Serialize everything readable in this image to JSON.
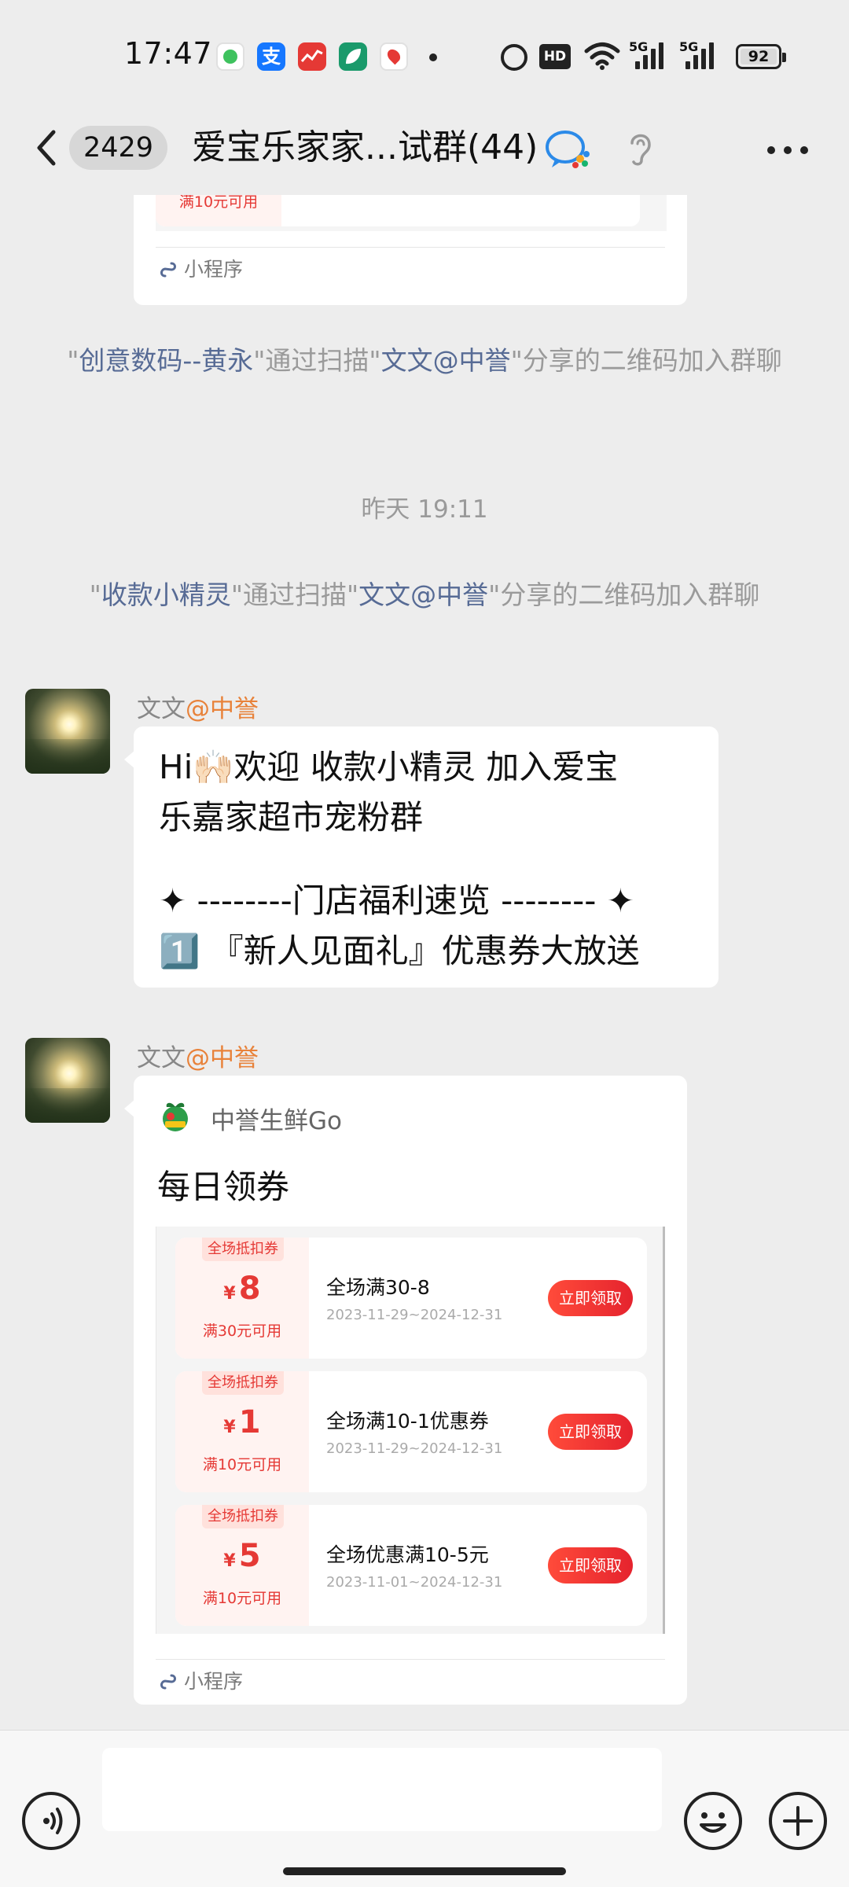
{
  "status_bar": {
    "time": "17:47",
    "hd_label": "HD",
    "signal1_label": "5G",
    "signal2_label": "5G",
    "battery_level": "92",
    "icons": [
      "wechat-app-icon",
      "alipay-app-icon",
      "stock-app-icon",
      "leaf-app-icon",
      "map-app-icon",
      "alarm-icon",
      "wifi-icon",
      "battery-icon"
    ]
  },
  "header": {
    "unread_count": "2429",
    "title": "爱宝乐家家...试群(44)",
    "icons": [
      "back-icon",
      "wecom-icon",
      "ear-icon",
      "more-icon"
    ]
  },
  "messages": {
    "top_card": {
      "coupon_condition": "满10元可用",
      "footer_label": "小程序"
    },
    "system1": {
      "q1": "\"",
      "name": "创意数码--黄永",
      "q2": "\"通过扫描\"",
      "inviter": "文文@中誉",
      "q3": "\"分享的二维码加入群聊"
    },
    "timestamp": "昨天 19:11",
    "system2": {
      "q1": "\"",
      "name": "收款小精灵",
      "q2": "\"通过扫描\"",
      "inviter": "文文@中誉",
      "q3": "\"分享的二维码加入群聊"
    },
    "msg1": {
      "sender_name": "文文",
      "sender_org": "@中誉",
      "lines": [
        "Hi🙌🏻欢迎  收款小精灵 加入爱宝",
        "乐嘉家超市宠粉群",
        "✦ --------门店福利速览 -------- ✦",
        "1️⃣ 『新人见面礼』优惠券大放送"
      ]
    },
    "msg2": {
      "sender_name": "文文",
      "sender_org": "@中誉",
      "mini_program_name": "中誉生鲜Go",
      "title": "每日领券",
      "coupons": [
        {
          "tag": "全场抵扣券",
          "currency": "¥",
          "amount": "8",
          "condition": "满30元可用",
          "name": "全场满30-8",
          "date": "2023-11-29~2024-12-31",
          "button": "立即领取"
        },
        {
          "tag": "全场抵扣券",
          "currency": "¥",
          "amount": "1",
          "condition": "满10元可用",
          "name": "全场满10-1优惠券",
          "date": "2023-11-29~2024-12-31",
          "button": "立即领取"
        },
        {
          "tag": "全场抵扣券",
          "currency": "¥",
          "amount": "5",
          "condition": "满10元可用",
          "name": "全场优惠满10-5元",
          "date": "2023-11-01~2024-12-31",
          "button": "立即领取"
        }
      ],
      "footer_label": "小程序"
    }
  },
  "input_bar": {
    "icons": [
      "voice-icon",
      "emoji-icon",
      "plus-icon"
    ]
  },
  "colors": {
    "background": "#ededed",
    "link": "#576b95",
    "accent_orange": "#e8823a",
    "coupon_red": "#e53935"
  }
}
